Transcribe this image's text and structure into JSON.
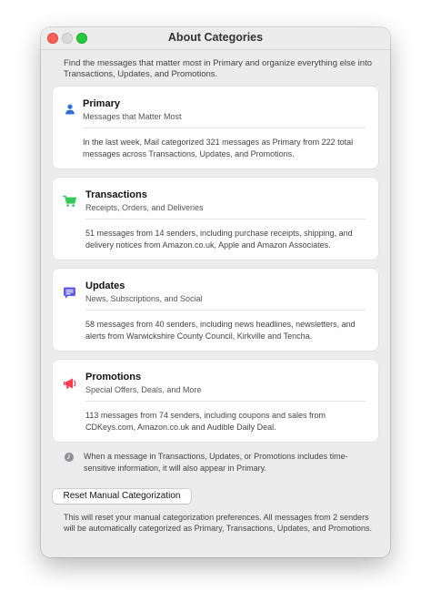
{
  "window": {
    "title": "About Categories"
  },
  "intro": "Find the messages that matter most in Primary and organize everything else into Transactions, Updates, and Promotions.",
  "categories": [
    {
      "title": "Primary",
      "subtitle": "Messages that Matter Most",
      "description": "In the last week, Mail categorized 321 messages as Primary from 222 total messages across Transactions, Updates, and Promotions.",
      "icon": "person-icon",
      "color": "#2f6fdb"
    },
    {
      "title": "Transactions",
      "subtitle": "Receipts, Orders, and Deliveries",
      "description": "51 messages from 14 senders, including purchase receipts, shipping, and delivery notices from Amazon.co.uk, Apple and Amazon Associates.",
      "icon": "cart-icon",
      "color": "#34c759"
    },
    {
      "title": "Updates",
      "subtitle": "News, Subscriptions, and Social",
      "description": "58 messages from 40 senders, including news headlines, newsletters, and alerts from Warwickshire County Council, Kirkville and Tencha.",
      "icon": "message-bubble-icon",
      "color": "#5e5ce6"
    },
    {
      "title": "Promotions",
      "subtitle": "Special Offers, Deals, and More",
      "description": "113 messages from 74 senders, including coupons and sales from CDKeys.com, Amazon.co.uk and Audible Daily Deal.",
      "icon": "megaphone-icon",
      "color": "#ff3b4e"
    }
  ],
  "note": "When a message in Transactions, Updates, or Promotions includes time-sensitive information, it will also appear in Primary.",
  "reset": {
    "button_label": "Reset Manual Categorization",
    "description": "This will reset your manual categorization preferences. All messages from 2 senders will be automatically categorized as Primary, Transactions, Updates, and Promotions."
  }
}
